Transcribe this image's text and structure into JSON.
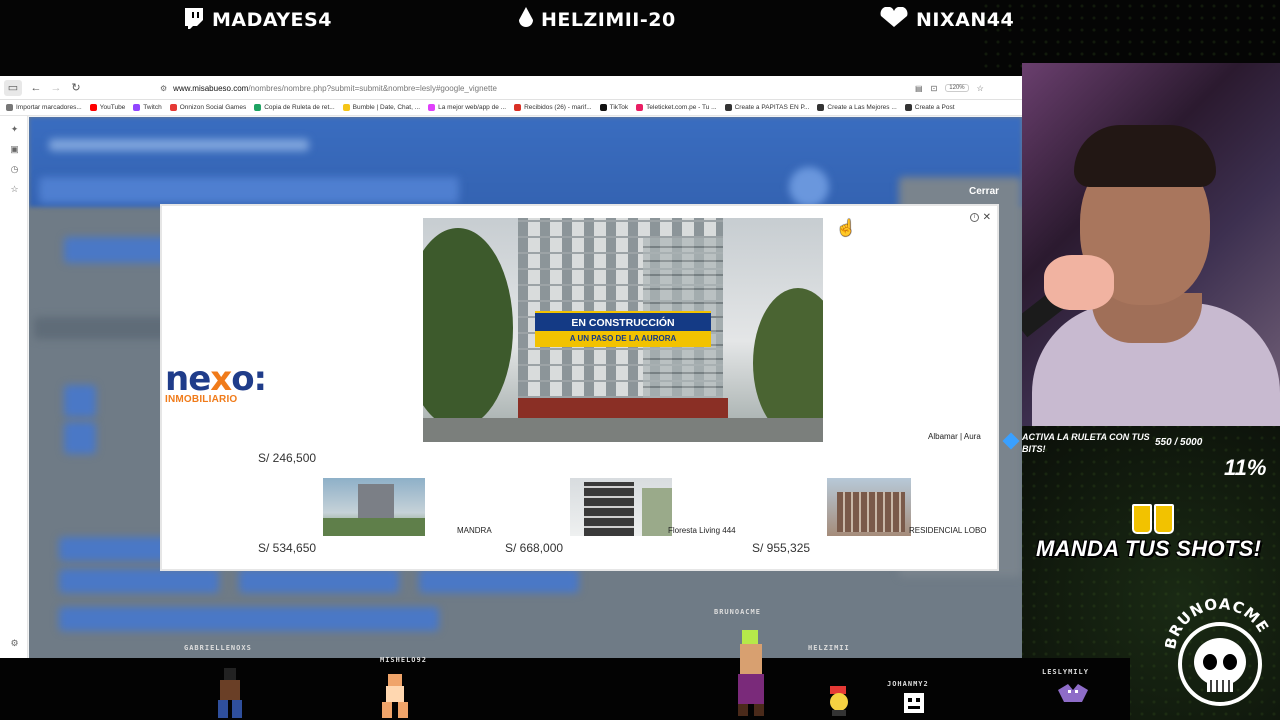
{
  "stream": {
    "socials": [
      {
        "platform": "twitch",
        "handle": "MADAYES4"
      },
      {
        "platform": "drop",
        "handle": "HELZIMII-20"
      },
      {
        "platform": "heart",
        "handle": "NIXAN44"
      }
    ]
  },
  "browser": {
    "url_host": "www.misabueso.com",
    "url_path": "/nombres/nombre.php?submit=submit&nombre=lesly#google_vignette",
    "zoom": "120%",
    "bookmarks": [
      {
        "label": "Importar marcadores...",
        "color": "#777777"
      },
      {
        "label": "YouTube",
        "color": "#ff0000"
      },
      {
        "label": "Twitch",
        "color": "#9146ff"
      },
      {
        "label": "Onnizon Social Games",
        "color": "#e53935"
      },
      {
        "label": "Copia de Ruleta de ret...",
        "color": "#1ea362"
      },
      {
        "label": "Bumble | Date, Chat, ...",
        "color": "#f5c518"
      },
      {
        "label": "La mejor web/app de ...",
        "color": "#e040fb"
      },
      {
        "label": "Recibidos (26) - marif...",
        "color": "#d93025"
      },
      {
        "label": "TikTok",
        "color": "#111111"
      },
      {
        "label": "Teleticket.com.pe - Tu ...",
        "color": "#e91e63"
      },
      {
        "label": "Create a PAPITAS EN P...",
        "color": "#333333"
      },
      {
        "label": "Create a Las Mejores ...",
        "color": "#333333"
      },
      {
        "label": "Create a Post",
        "color": "#333333"
      }
    ]
  },
  "ad": {
    "close_label": "Cerrar",
    "hero_banner_line1": "EN CONSTRUCCIÓN",
    "hero_banner_line2": "A UN PASO DE LA AURORA",
    "logo_text_a": "ne",
    "logo_text_b": "x",
    "logo_text_c": "o:",
    "logo_sub": "INMOBILIARIO",
    "hero_caption": "Albamar | Aura",
    "hero_price": "S/ 246,500",
    "listings": [
      {
        "name": "MANDRA",
        "price": "S/ 534,650"
      },
      {
        "name": "Floresta Living 444",
        "price": "S/ 668,000"
      },
      {
        "name": "RESIDENCIAL LOBO",
        "price": "S/ 955,325"
      }
    ]
  },
  "overlay": {
    "bits_text": "ACTIVA LA RULETA CON TUS BITS!",
    "bits_count": "550 / 5000",
    "bits_percent": "11%",
    "shots_text": "MANDA TUS SHOTS!",
    "brand": "BRUNOACME",
    "viewers": [
      "GABRIELLENOXS",
      "MISHELO92",
      "BRUNOACME",
      "HELZIMII",
      "JOHANMY2",
      "LESLYMILY"
    ]
  }
}
